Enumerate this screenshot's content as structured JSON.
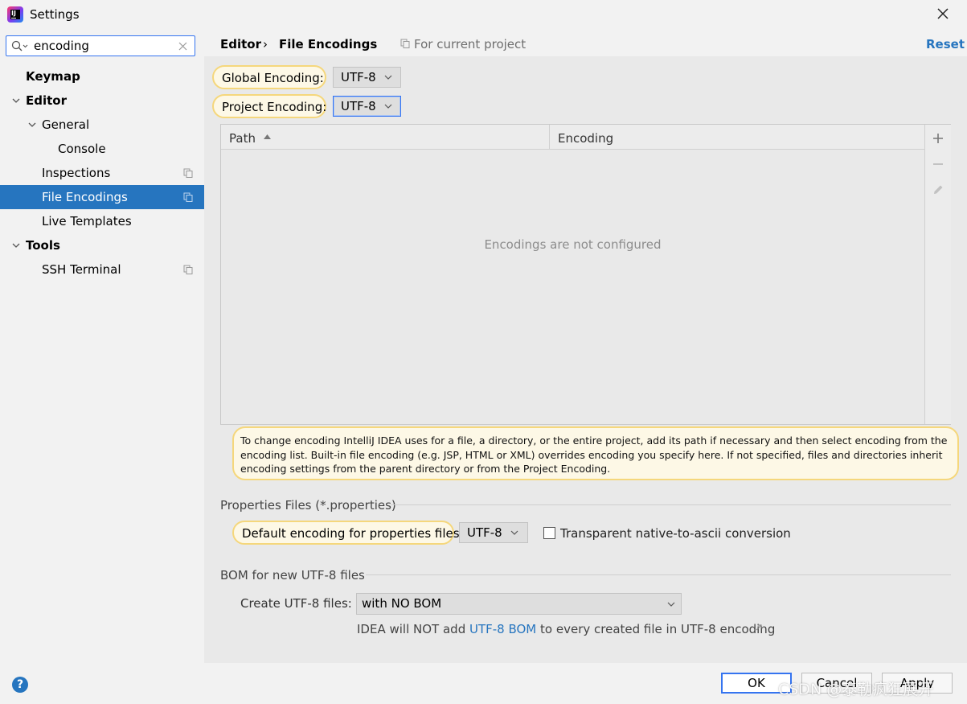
{
  "window": {
    "title": "Settings"
  },
  "search": {
    "value": "encoding"
  },
  "sidebar": {
    "items": [
      {
        "label": "Keymap"
      },
      {
        "label": "Editor"
      },
      {
        "label": "General"
      },
      {
        "label": "Console"
      },
      {
        "label": "Inspections"
      },
      {
        "label": "File Encodings"
      },
      {
        "label": "Live Templates"
      },
      {
        "label": "Tools"
      },
      {
        "label": "SSH Terminal"
      }
    ]
  },
  "header": {
    "breadcrumb_parent": "Editor",
    "breadcrumb_sep": "›",
    "breadcrumb_current": "File Encodings",
    "scope": "For current project",
    "reset_label": "Reset"
  },
  "encodings": {
    "global_label": "Global Encoding:",
    "global_value": "UTF-8",
    "project_label": "Project Encoding:",
    "project_value": "UTF-8"
  },
  "table": {
    "col_path": "Path",
    "col_encoding": "Encoding",
    "empty_text": "Encodings are not configured"
  },
  "help_text": "To change encoding IntelliJ IDEA uses for a file, a directory, or the entire project, add its path if necessary and then select encoding from the encoding list. Built-in file encoding (e.g. JSP, HTML or XML) overrides encoding you specify here. If not specified, files and directories inherit encoding settings from the parent directory or from the Project Encoding.",
  "properties": {
    "section_title": "Properties Files (*.properties)",
    "default_label": "Default encoding for properties files:",
    "default_value": "UTF-8",
    "checkbox_label": "Transparent native-to-ascii conversion",
    "checkbox_checked": false
  },
  "bom": {
    "section_title": "BOM for new UTF-8 files",
    "create_label": "Create UTF-8 files:",
    "create_value": "with NO BOM",
    "note_prefix": "IDEA will NOT add ",
    "note_link": "UTF-8 BOM",
    "note_suffix": " to every created file in UTF-8 encoding"
  },
  "footer": {
    "help": "?",
    "ok": "OK",
    "cancel": "Cancel",
    "apply": "Apply"
  },
  "watermark": "CSDN @泰勒疯狂展开",
  "colors": {
    "accent": "#2675bf",
    "highlight": "#f5d77c",
    "focus": "#3574f0"
  }
}
